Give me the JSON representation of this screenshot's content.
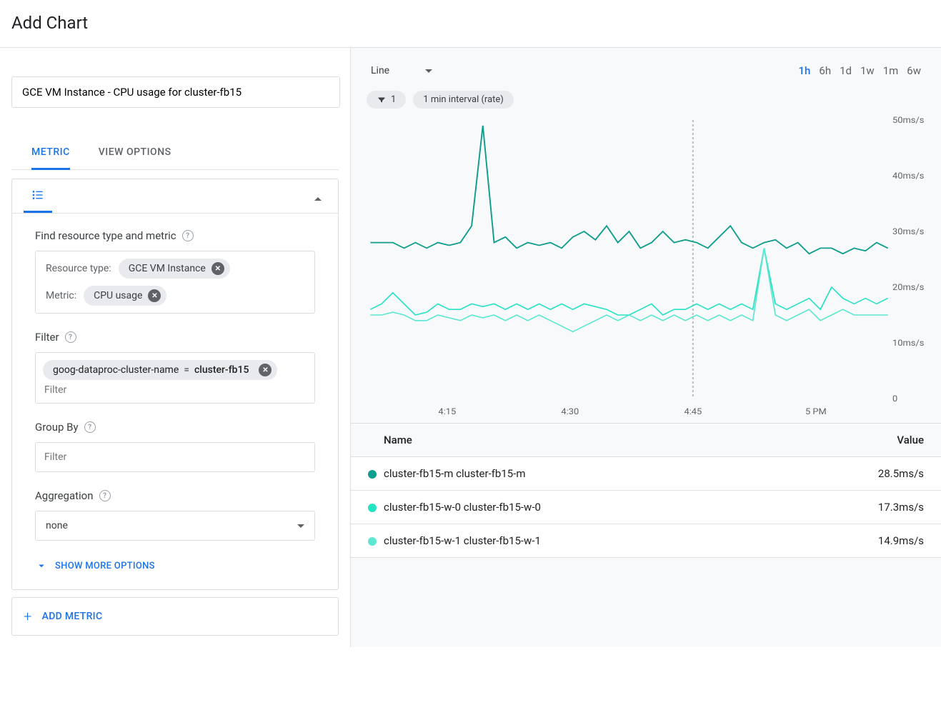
{
  "header": {
    "title": "Add Chart"
  },
  "title_input": {
    "value": "GCE VM Instance - CPU usage for cluster-fb15"
  },
  "tabs": {
    "metric": "METRIC",
    "view_options": "VIEW OPTIONS"
  },
  "finder": {
    "heading": "Find resource type and metric",
    "resource_type_label": "Resource type:",
    "resource_type_value": "GCE VM Instance",
    "metric_label": "Metric:",
    "metric_value": "CPU usage"
  },
  "filter": {
    "heading": "Filter",
    "chip_key": "goog-dataproc-cluster-name",
    "chip_eq": "=",
    "chip_val": "cluster-fb15",
    "placeholder": "Filter"
  },
  "group_by": {
    "heading": "Group By",
    "placeholder": "Filter"
  },
  "aggregation": {
    "heading": "Aggregation",
    "value": "none"
  },
  "show_more": "SHOW MORE OPTIONS",
  "add_metric": "ADD METRIC",
  "chart_header": {
    "type": "Line",
    "ranges": [
      "1h",
      "6h",
      "1d",
      "1w",
      "1m",
      "6w"
    ],
    "active_range": "1h",
    "filter_count": "1",
    "interval": "1 min interval (rate)"
  },
  "legend": {
    "name_col": "Name",
    "value_col": "Value",
    "rows": [
      {
        "color": "#0f9d8d",
        "name": "cluster-fb15-m cluster-fb15-m",
        "value": "28.5ms/s"
      },
      {
        "color": "#26e2c5",
        "name": "cluster-fb15-w-0 cluster-fb15-w-0",
        "value": "17.3ms/s"
      },
      {
        "color": "#5de6d0",
        "name": "cluster-fb15-w-1 cluster-fb15-w-1",
        "value": "14.9ms/s"
      }
    ]
  },
  "chart_data": {
    "type": "line",
    "xlabel": "",
    "ylabel": "",
    "ylim": [
      0,
      50
    ],
    "y_unit": "ms/s",
    "y_ticks": [
      "50ms/s",
      "40ms/s",
      "30ms/s",
      "20ms/s",
      "10ms/s",
      "0"
    ],
    "x_ticks": [
      "4:15",
      "4:30",
      "4:45",
      "5 PM"
    ],
    "cursor_at": "4:45",
    "series": [
      {
        "name": "cluster-fb15-m",
        "color": "#0f9d8d",
        "values": [
          28,
          28,
          28,
          27,
          28,
          27,
          28,
          27.5,
          28,
          31,
          49,
          28,
          29,
          27,
          28,
          27.5,
          28,
          27,
          29,
          30,
          28.5,
          31,
          28,
          30,
          27,
          28,
          30,
          28,
          28.5,
          28,
          27,
          29,
          31,
          28,
          27,
          28,
          28.5,
          27,
          28,
          26,
          27,
          27,
          26,
          27,
          26.5,
          28,
          27
        ]
      },
      {
        "name": "cluster-fb15-w-0",
        "color": "#26e2c5",
        "values": [
          16,
          17,
          19,
          17,
          15,
          15.5,
          17,
          16,
          16,
          17,
          16.5,
          17,
          16,
          17,
          16,
          17,
          16,
          17,
          16,
          17,
          16.5,
          16,
          15,
          15,
          16,
          17,
          15,
          16,
          16,
          17,
          16,
          17,
          16,
          17,
          16,
          27,
          17,
          16,
          17,
          18,
          16,
          20,
          18,
          17,
          18,
          17,
          18
        ]
      },
      {
        "name": "cluster-fb15-w-1",
        "color": "#5de6d0",
        "values": [
          15,
          15,
          15.5,
          15,
          14,
          14,
          15,
          14.5,
          14,
          15,
          14.5,
          15,
          14,
          15,
          14,
          15,
          14,
          13,
          12,
          13,
          14,
          15,
          14,
          15,
          14,
          15,
          14,
          15,
          14,
          15,
          14,
          15,
          14,
          15,
          14,
          27,
          15,
          14,
          15,
          16,
          14,
          15,
          16,
          15,
          15,
          15,
          15
        ]
      }
    ]
  }
}
